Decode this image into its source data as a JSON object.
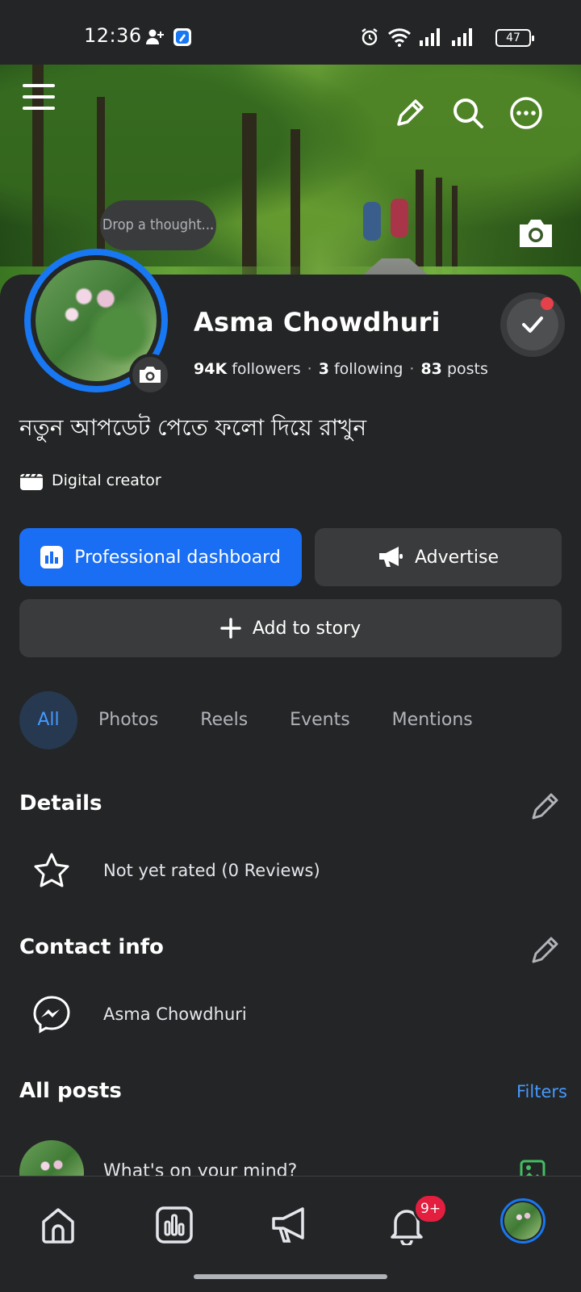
{
  "status_bar": {
    "time": "12:36",
    "battery": "47",
    "icons": [
      "person-add-icon",
      "app-badge-icon",
      "alarm-icon",
      "wifi-icon",
      "signal-icon",
      "signal-icon",
      "battery-icon"
    ]
  },
  "header": {
    "icons": [
      "menu-icon",
      "edit-icon",
      "search-icon",
      "more-icon",
      "camera-icon"
    ]
  },
  "profile": {
    "thought_placeholder": "Drop a thought...",
    "name": "Asma Chowdhuri",
    "followers_count": "94K",
    "followers_label": "followers",
    "following_count": "3",
    "following_label": "following",
    "posts_count": "83",
    "posts_label": "posts",
    "bio": "নতুন আপডেট পেতে ফলো দিয়ে রাখুন",
    "category": "Digital creator"
  },
  "actions": {
    "dashboard": "Professional dashboard",
    "advertise": "Advertise",
    "add_story": "Add to story"
  },
  "tabs": [
    {
      "label": "All",
      "active": true
    },
    {
      "label": "Photos",
      "active": false
    },
    {
      "label": "Reels",
      "active": false
    },
    {
      "label": "Events",
      "active": false
    },
    {
      "label": "Mentions",
      "active": false
    }
  ],
  "details": {
    "title": "Details",
    "rating": "Not yet rated (0 Reviews)"
  },
  "contact": {
    "title": "Contact info",
    "messenger": "Asma Chowdhuri"
  },
  "posts": {
    "title": "All posts",
    "filters": "Filters",
    "composer_placeholder": "What's on your mind?"
  },
  "bottom_nav": {
    "items": [
      "home-icon",
      "dashboard-icon",
      "megaphone-icon",
      "bell-icon",
      "profile-avatar"
    ],
    "notification_badge": "9+"
  },
  "colors": {
    "background": "#242526",
    "primary": "#1a6ef4",
    "secondary_button": "#3a3b3c",
    "link": "#4599ff",
    "badge": "#e41e3f"
  }
}
